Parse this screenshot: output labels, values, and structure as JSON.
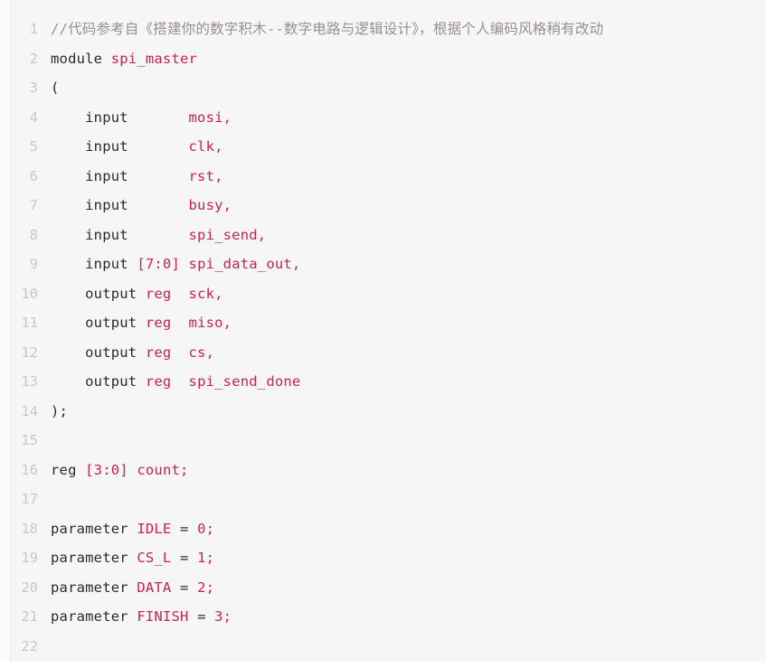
{
  "editor": {
    "language": "verilog",
    "background_color": "#f6f6f6",
    "gutter_color": "#c8c8c8",
    "text_color": "#2b2b2b",
    "identifier_color": "#c7254e",
    "comment_color": "#998f8f",
    "first_line_number": 1,
    "last_line_number": 22,
    "total_lines": 22
  },
  "lines": [
    {
      "number": "1",
      "tokens": [
        {
          "t": "//代码参考自《搭建你的数字积木--数字电路与逻辑设计》，根据个人编码风格稍有改动",
          "c": "tok-comment"
        }
      ]
    },
    {
      "number": "2",
      "tokens": [
        {
          "t": "module ",
          "c": "tok-kw"
        },
        {
          "t": "spi_master",
          "c": "tok-ident"
        }
      ]
    },
    {
      "number": "3",
      "tokens": [
        {
          "t": "(",
          "c": "tok-punc"
        }
      ]
    },
    {
      "number": "4",
      "tokens": [
        {
          "t": "    input       ",
          "c": "tok-kw"
        },
        {
          "t": "mosi,",
          "c": "tok-ident"
        }
      ]
    },
    {
      "number": "5",
      "tokens": [
        {
          "t": "    input       ",
          "c": "tok-kw"
        },
        {
          "t": "clk,",
          "c": "tok-ident"
        }
      ]
    },
    {
      "number": "6",
      "tokens": [
        {
          "t": "    input       ",
          "c": "tok-kw"
        },
        {
          "t": "rst,",
          "c": "tok-ident"
        }
      ]
    },
    {
      "number": "7",
      "tokens": [
        {
          "t": "    input       ",
          "c": "tok-kw"
        },
        {
          "t": "busy,",
          "c": "tok-ident"
        }
      ]
    },
    {
      "number": "8",
      "tokens": [
        {
          "t": "    input       ",
          "c": "tok-kw"
        },
        {
          "t": "spi_send,",
          "c": "tok-ident"
        }
      ]
    },
    {
      "number": "9",
      "tokens": [
        {
          "t": "    input ",
          "c": "tok-kw"
        },
        {
          "t": "[7:0] ",
          "c": "tok-num"
        },
        {
          "t": "spi_data_out,",
          "c": "tok-ident"
        }
      ]
    },
    {
      "number": "10",
      "tokens": [
        {
          "t": "    output ",
          "c": "tok-kw"
        },
        {
          "t": "reg",
          "c": "tok-ident"
        },
        {
          "t": "  ",
          "c": "tok-plain"
        },
        {
          "t": "sck,",
          "c": "tok-ident"
        }
      ]
    },
    {
      "number": "11",
      "tokens": [
        {
          "t": "    output ",
          "c": "tok-kw"
        },
        {
          "t": "reg",
          "c": "tok-ident"
        },
        {
          "t": "  ",
          "c": "tok-plain"
        },
        {
          "t": "miso,",
          "c": "tok-ident"
        }
      ]
    },
    {
      "number": "12",
      "tokens": [
        {
          "t": "    output ",
          "c": "tok-kw"
        },
        {
          "t": "reg",
          "c": "tok-ident"
        },
        {
          "t": "  ",
          "c": "tok-plain"
        },
        {
          "t": "cs,",
          "c": "tok-ident"
        }
      ]
    },
    {
      "number": "13",
      "tokens": [
        {
          "t": "    output ",
          "c": "tok-kw"
        },
        {
          "t": "reg",
          "c": "tok-ident"
        },
        {
          "t": "  ",
          "c": "tok-plain"
        },
        {
          "t": "spi_send_done",
          "c": "tok-ident"
        }
      ]
    },
    {
      "number": "14",
      "tokens": [
        {
          "t": ");",
          "c": "tok-punc"
        }
      ]
    },
    {
      "number": "15",
      "tokens": []
    },
    {
      "number": "16",
      "tokens": [
        {
          "t": "reg ",
          "c": "tok-kw"
        },
        {
          "t": "[3:0] ",
          "c": "tok-num"
        },
        {
          "t": "count;",
          "c": "tok-ident"
        }
      ]
    },
    {
      "number": "17",
      "tokens": []
    },
    {
      "number": "18",
      "tokens": [
        {
          "t": "parameter ",
          "c": "tok-kw"
        },
        {
          "t": "IDLE ",
          "c": "tok-ident"
        },
        {
          "t": "= ",
          "c": "tok-punc"
        },
        {
          "t": "0;",
          "c": "tok-num"
        }
      ]
    },
    {
      "number": "19",
      "tokens": [
        {
          "t": "parameter ",
          "c": "tok-kw"
        },
        {
          "t": "CS_L ",
          "c": "tok-ident"
        },
        {
          "t": "= ",
          "c": "tok-punc"
        },
        {
          "t": "1;",
          "c": "tok-num"
        }
      ]
    },
    {
      "number": "20",
      "tokens": [
        {
          "t": "parameter ",
          "c": "tok-kw"
        },
        {
          "t": "DATA ",
          "c": "tok-ident"
        },
        {
          "t": "= ",
          "c": "tok-punc"
        },
        {
          "t": "2;",
          "c": "tok-num"
        }
      ]
    },
    {
      "number": "21",
      "tokens": [
        {
          "t": "parameter ",
          "c": "tok-kw"
        },
        {
          "t": "FINISH ",
          "c": "tok-ident"
        },
        {
          "t": "= ",
          "c": "tok-punc"
        },
        {
          "t": "3;",
          "c": "tok-num"
        }
      ]
    },
    {
      "number": "22",
      "tokens": []
    }
  ]
}
